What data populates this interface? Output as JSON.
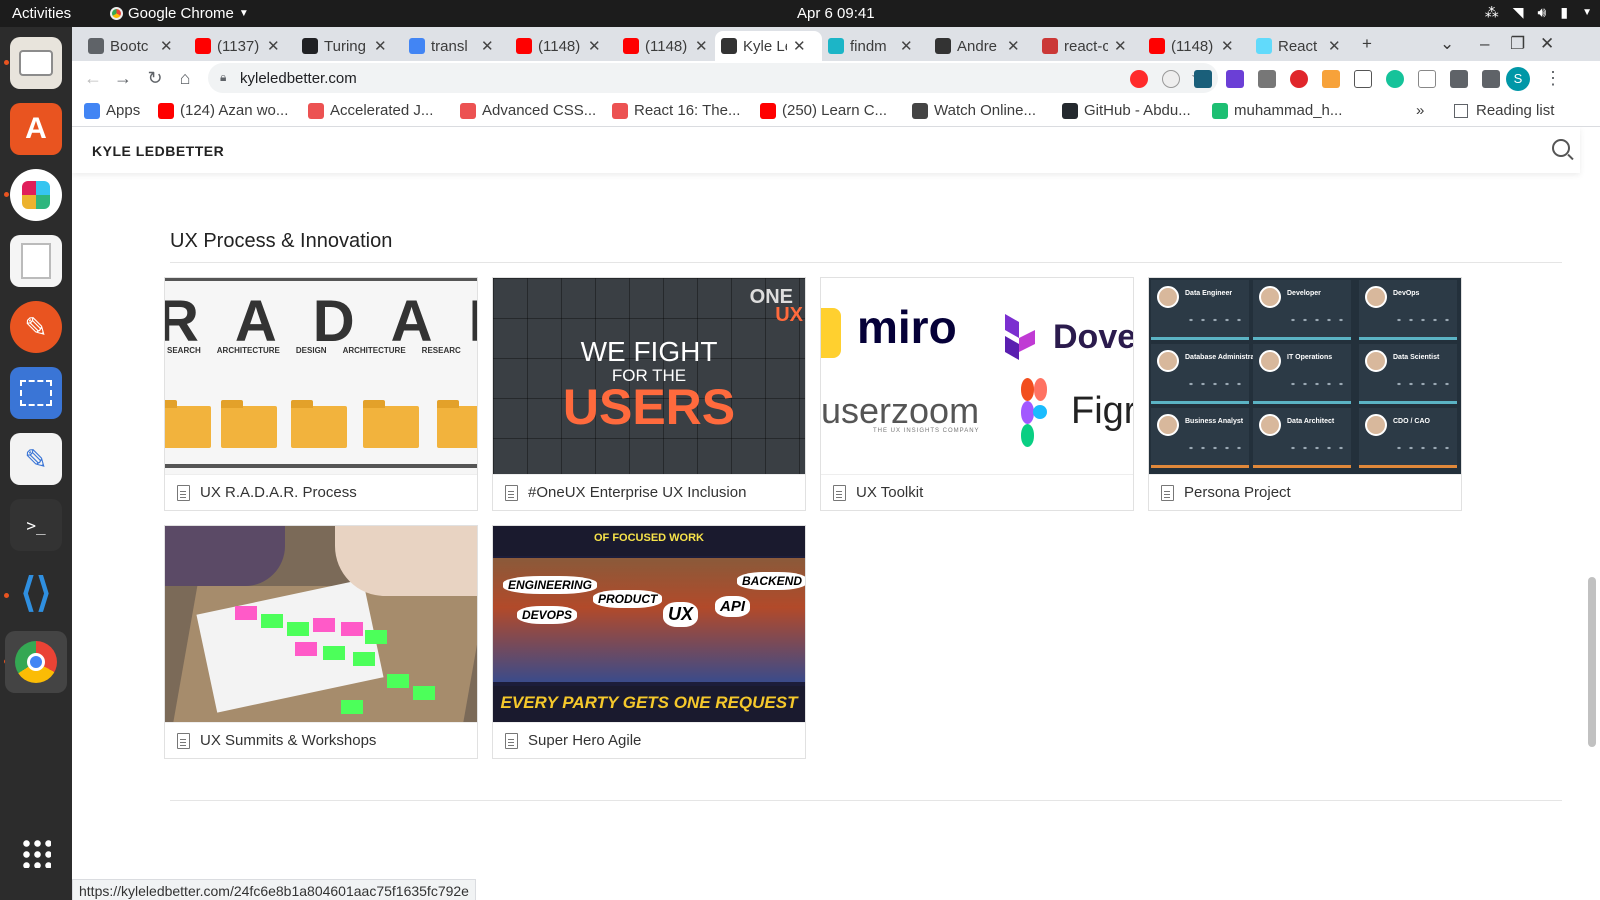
{
  "os": {
    "activities": "Activities",
    "app_name": "Google Chrome",
    "clock": "Apr 6  09:41"
  },
  "tabs": [
    {
      "title": "Bootc",
      "favicon": "globe-icon",
      "color": "#5f6368"
    },
    {
      "title": "(1137)",
      "favicon": "youtube-icon",
      "color": "#ff0000"
    },
    {
      "title": "Turing",
      "favicon": "turing-icon",
      "color": "#202124"
    },
    {
      "title": "transl",
      "favicon": "google-icon",
      "color": "#4285f4"
    },
    {
      "title": "(1148)",
      "favicon": "youtube-icon",
      "color": "#ff0000"
    },
    {
      "title": "(1148)",
      "favicon": "youtube-icon",
      "color": "#ff0000"
    },
    {
      "title": "Kyle Le",
      "favicon": "person-icon",
      "color": "#333333",
      "active": true
    },
    {
      "title": "findm",
      "favicon": "findm-icon",
      "color": "#1cb5c7"
    },
    {
      "title": "Andre",
      "favicon": "code-icon",
      "color": "#333333"
    },
    {
      "title": "react-c",
      "favicon": "npm-icon",
      "color": "#cb3837"
    },
    {
      "title": "(1148)",
      "favicon": "youtube-icon",
      "color": "#ff0000"
    },
    {
      "title": "React",
      "favicon": "react-icon",
      "color": "#61dafb"
    }
  ],
  "address_bar": {
    "url": "kyleledbetter.com"
  },
  "bookmarks": [
    {
      "label": "Apps",
      "icon": "apps-grid-icon",
      "color": "#4285f4"
    },
    {
      "label": "(124) Azan wo...",
      "icon": "youtube-icon",
      "color": "#ff0000"
    },
    {
      "label": "Accelerated J...",
      "icon": "udemy-icon",
      "color": "#ec5252"
    },
    {
      "label": "Advanced CSS...",
      "icon": "udemy-icon",
      "color": "#ec5252"
    },
    {
      "label": "React 16: The...",
      "icon": "udemy-icon",
      "color": "#ec5252"
    },
    {
      "label": "(250) Learn C...",
      "icon": "youtube-icon",
      "color": "#ff0000"
    },
    {
      "label": "Watch Online...",
      "icon": "film-icon",
      "color": "#444444"
    },
    {
      "label": "GitHub - Abdu...",
      "icon": "github-icon",
      "color": "#24292e"
    },
    {
      "label": "muhammad_h...",
      "icon": "fiverr-icon",
      "color": "#1dbf73"
    }
  ],
  "reading_list": "Reading list",
  "site": {
    "brand": "KYLE LEDBETTER",
    "section_title": "UX Process & Innovation",
    "cards": [
      {
        "title": "UX R.A.D.A.R. Process"
      },
      {
        "title": "#OneUX Enterprise UX Inclusion"
      },
      {
        "title": "UX Toolkit"
      },
      {
        "title": "Persona Project"
      },
      {
        "title": "UX Summits & Workshops"
      },
      {
        "title": "Super Hero Agile"
      }
    ],
    "thumbs": {
      "radar": {
        "letters": [
          "R",
          "A",
          "D",
          "A",
          "R"
        ],
        "labels": [
          "SEARCH",
          "ARCHITECTURE",
          "DESIGN",
          "ARCHITECTURE",
          "RESEARC"
        ]
      },
      "fight": {
        "one": "ONE",
        "ux": "UX",
        "line1": "WE FIGHT",
        "line2": "FOR THE",
        "line3": "USERS"
      },
      "tools": {
        "miro": "miro",
        "dovetail": "Dovet",
        "userzoom": "userzoom",
        "userzoom_sub": "THE UX INSIGHTS COMPANY",
        "figma": "Figr"
      },
      "persona": {
        "roles": [
          "Data Engineer",
          "Developer",
          "DevOps",
          "Database Administrator",
          "IT Operations",
          "Data Scientist",
          "Business Analyst",
          "Data Architect",
          "CDO / CAO"
        ]
      },
      "hero": {
        "top": "OF FOCUSED WORK",
        "bottom": "EVERY PARTY GETS ONE REQUEST",
        "b1": "ENGINEERING",
        "b2": "PRODUCT",
        "b3": "DEVOPS",
        "b4": "UX",
        "b5": "API",
        "b6": "BACKEND"
      }
    },
    "status_url": "https://kyleledbetter.com/24fc6e8b1a804601aac75f1635fc792e"
  }
}
